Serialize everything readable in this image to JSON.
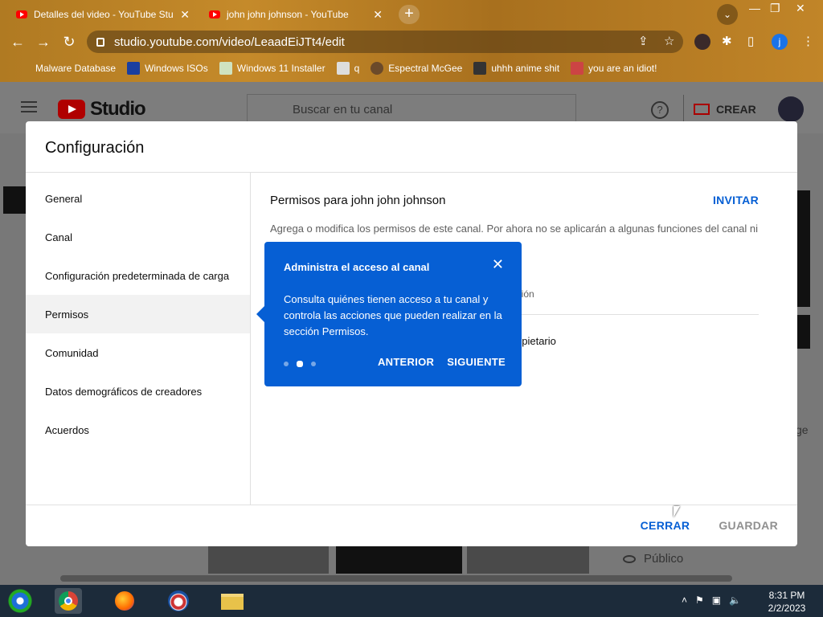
{
  "browser": {
    "tabs": [
      {
        "title": "Detalles del video - YouTube Stu"
      },
      {
        "title": "john john johnson - YouTube"
      }
    ],
    "new_tab": "+",
    "url": "studio.youtube.com/video/LeaadEiJTt4/edit",
    "profile_initial": "j",
    "bookmarks": [
      {
        "label": "Malware Database"
      },
      {
        "label": "Windows ISOs"
      },
      {
        "label": "Windows 11 Installer"
      },
      {
        "label": "q"
      },
      {
        "label": "Espectral McGee"
      },
      {
        "label": "uhhh anime shit"
      },
      {
        "label": "you are an idiot!"
      }
    ]
  },
  "studio": {
    "logo_text": "Studio",
    "search_placeholder": "Buscar en tu canal",
    "help": "?",
    "create_label": "CREAR",
    "visibility_label": "Público",
    "partial_text": "ge"
  },
  "dialog": {
    "title": "Configuración",
    "nav": [
      {
        "label": "General"
      },
      {
        "label": "Canal"
      },
      {
        "label": "Configuración predeterminada de carga"
      },
      {
        "label": "Permisos"
      },
      {
        "label": "Comunidad"
      },
      {
        "label": "Datos demográficos de creadores"
      },
      {
        "label": "Acuerdos"
      }
    ],
    "active_nav": "Permisos",
    "permissions_title": "Permisos para john john johnson",
    "invite_label": "INVITAR",
    "description": "Agrega o modifica los permisos de este canal. Por ahora no se aplicarán a algunas funciones del canal ni",
    "column_role": "nción",
    "owner_role": "opietario",
    "close_label": "CERRAR",
    "save_label": "GUARDAR"
  },
  "tooltip": {
    "title": "Administra el acceso al canal",
    "body": "Consulta quiénes tienen acceso a tu canal y controla las acciones que pueden realizar en la sección Permisos.",
    "prev_label": "ANTERIOR",
    "next_label": "SIGUIENTE",
    "step": 2,
    "steps": 3
  },
  "taskbar": {
    "time": "8:31 PM",
    "date": "2/2/2023"
  },
  "colors": {
    "accent": "#065fd4",
    "youtube_red": "#ff0000",
    "taskbar": "#1c2b3a"
  }
}
